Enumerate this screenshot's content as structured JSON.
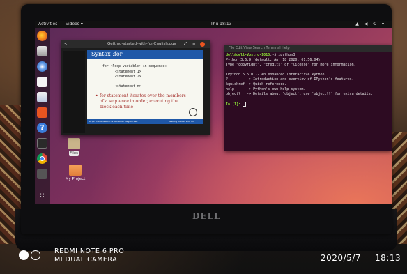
{
  "topbar": {
    "activities": "Activities",
    "app_menu": "Videos ▾",
    "clock": "Thu 18:13",
    "tray": "▲ ◀ ⏻ ▾"
  },
  "dock": {
    "apps": [
      "firefox",
      "files",
      "thunderbird",
      "rhythmbox",
      "libreoffice-writer",
      "ubuntu-software",
      "help",
      "terminal",
      "chrome",
      "unknown-app",
      "show-applications"
    ],
    "help_glyph": "?",
    "appgrid_glyph": "∷"
  },
  "desktop": {
    "icons": [
      {
        "label": "Files",
        "type": "file"
      },
      {
        "label": "My Project",
        "type": "folder"
      }
    ]
  },
  "video_window": {
    "back_glyph": "<",
    "title": "Getting-started-with-for-English.ogv",
    "fullscreen_glyph": "⤢",
    "menu_glyph": "≡",
    "slide": {
      "heading": "Syntax :for",
      "code": [
        "for <loop variable> in sequence:",
        "<statement 1>",
        "<statement 2>",
        "...",
        "<statement n>"
      ],
      "bullet": "for statement iterates over the members of a sequence in order, executing the block each time",
      "footer_left": "Script: Thirumalesh H S  Narration: Nagesh Rao",
      "footer_right": "Getting started with for"
    }
  },
  "terminal": {
    "menu": "File  Edit  View  Search  Terminal  Help",
    "prompt_user": "dell@dell-Vostro-1015",
    "prompt_rest": ":~$ ipython3",
    "lines": [
      "Python 3.6.9 (default, Apr 18 2020, 01:56:04)",
      "Type \"copyright\", \"credits\" or \"license\" for more information.",
      "",
      "IPython 5.5.0 -- An enhanced Interactive Python.",
      "?         -> Introduction and overview of IPython's features.",
      "%quickref -> Quick reference.",
      "help      -> Python's own help system.",
      "object?   -> Details about 'object', use 'object??' for extra details.",
      ""
    ],
    "in_prompt_open": "In [",
    "in_prompt_num": "1",
    "in_prompt_close": "]: "
  },
  "laptop": {
    "brand": "DELL"
  },
  "camera_watermark": {
    "device": "REDMI NOTE 6 PRO",
    "camera": "MI DUAL CAMERA",
    "date": "2020/5/7",
    "time": "18:13"
  }
}
